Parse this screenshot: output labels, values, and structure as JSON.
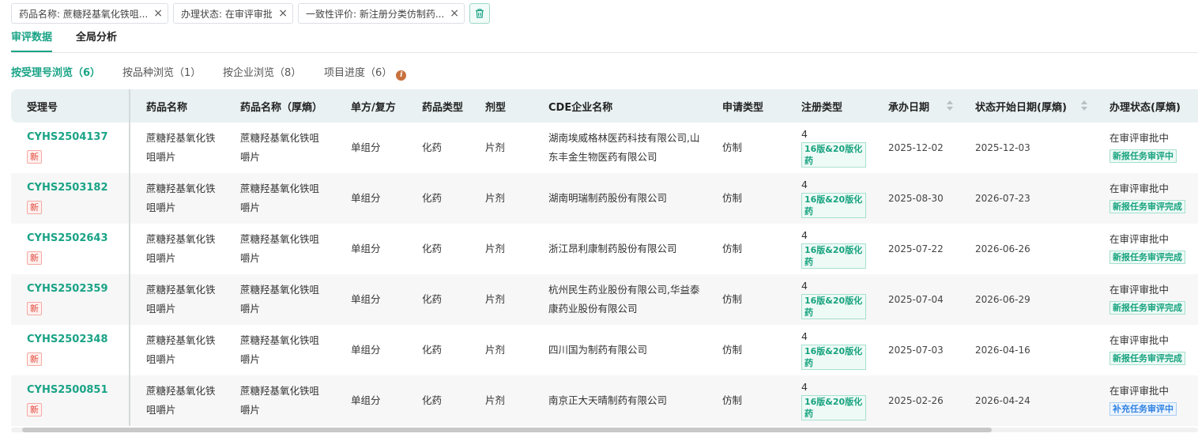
{
  "filters": [
    {
      "label": "药品名称: 蔗糖羟基氧化铁咀..."
    },
    {
      "label": "办理状态: 在审评审批中"
    },
    {
      "label": "一致性评价: 新注册分类仿制药..."
    }
  ],
  "filter_close_glyph": "×",
  "main_tabs": [
    {
      "label": "审评数据",
      "active": true
    },
    {
      "label": "全局分析",
      "active": false
    }
  ],
  "sub_tabs": [
    {
      "label": "按受理号浏览（6）",
      "active": true
    },
    {
      "label": "按品种浏览（1）",
      "active": false
    },
    {
      "label": "按企业浏览（8）",
      "active": false
    },
    {
      "label": "项目进度（6）",
      "active": false
    }
  ],
  "table": {
    "columns": [
      "受理号",
      "药品名称",
      "药品名称（厚熵）",
      "单方/复方",
      "药品类型",
      "剂型",
      "CDE企业名称",
      "申请类型",
      "注册类型",
      "承办日期",
      "状态开始日期(厚熵)",
      "办理状态(厚熵)"
    ],
    "rows": [
      {
        "acceptance_no": "CYHS2504137",
        "badge": "新",
        "drug_name": "蔗糖羟基氧化铁咀嚼片",
        "drug_name_alt": "蔗糖羟基氧化铁咀嚼片",
        "composition": "单组分",
        "drug_type": "化药",
        "dosage_form": "片剂",
        "company": "湖南埃威格林医药科技有限公司,山东丰金生物医药有限公司",
        "application_type": "仿制",
        "reg_class": "4",
        "reg_tag": "16版&20版化药",
        "undertake_date": "2025-12-02",
        "status_start_date": "2025-12-03",
        "status": "在审评审批中",
        "status_tag": "新报任务审评中",
        "status_tag_color": "green"
      },
      {
        "acceptance_no": "CYHS2503182",
        "badge": "新",
        "drug_name": "蔗糖羟基氧化铁咀嚼片",
        "drug_name_alt": "蔗糖羟基氧化铁咀嚼片",
        "composition": "单组分",
        "drug_type": "化药",
        "dosage_form": "片剂",
        "company": "湖南明瑞制药股份有限公司",
        "application_type": "仿制",
        "reg_class": "4",
        "reg_tag": "16版&20版化药",
        "undertake_date": "2025-08-30",
        "status_start_date": "2026-07-23",
        "status": "在审评审批中",
        "status_tag": "新报任务审评完成",
        "status_tag_color": "green"
      },
      {
        "acceptance_no": "CYHS2502643",
        "badge": "新",
        "drug_name": "蔗糖羟基氧化铁咀嚼片",
        "drug_name_alt": "蔗糖羟基氧化铁咀嚼片",
        "composition": "单组分",
        "drug_type": "化药",
        "dosage_form": "片剂",
        "company": "浙江昂利康制药股份有限公司",
        "application_type": "仿制",
        "reg_class": "4",
        "reg_tag": "16版&20版化药",
        "undertake_date": "2025-07-22",
        "status_start_date": "2026-06-26",
        "status": "在审评审批中",
        "status_tag": "新报任务审评完成",
        "status_tag_color": "green"
      },
      {
        "acceptance_no": "CYHS2502359",
        "badge": "新",
        "drug_name": "蔗糖羟基氧化铁咀嚼片",
        "drug_name_alt": "蔗糖羟基氧化铁咀嚼片",
        "composition": "单组分",
        "drug_type": "化药",
        "dosage_form": "片剂",
        "company": "杭州民生药业股份有限公司,华益泰康药业股份有限公司",
        "application_type": "仿制",
        "reg_class": "4",
        "reg_tag": "16版&20版化药",
        "undertake_date": "2025-07-04",
        "status_start_date": "2026-06-29",
        "status": "在审评审批中",
        "status_tag": "新报任务审评完成",
        "status_tag_color": "green"
      },
      {
        "acceptance_no": "CYHS2502348",
        "badge": "新",
        "drug_name": "蔗糖羟基氧化铁咀嚼片",
        "drug_name_alt": "蔗糖羟基氧化铁咀嚼片",
        "composition": "单组分",
        "drug_type": "化药",
        "dosage_form": "片剂",
        "company": "四川国为制药有限公司",
        "application_type": "仿制",
        "reg_class": "4",
        "reg_tag": "16版&20版化药",
        "undertake_date": "2025-07-03",
        "status_start_date": "2026-04-16",
        "status": "在审评审批中",
        "status_tag": "新报任务审评完成",
        "status_tag_color": "green"
      },
      {
        "acceptance_no": "CYHS2500851",
        "badge": "新",
        "drug_name": "蔗糖羟基氧化铁咀嚼片",
        "drug_name_alt": "蔗糖羟基氧化铁咀嚼片",
        "composition": "单组分",
        "drug_type": "化药",
        "dosage_form": "片剂",
        "company": "南京正大天晴制药有限公司",
        "application_type": "仿制",
        "reg_class": "4",
        "reg_tag": "16版&20版化药",
        "undertake_date": "2025-02-26",
        "status_start_date": "2026-04-24",
        "status": "在审评审批中",
        "status_tag": "补充任务审评中",
        "status_tag_color": "blue"
      }
    ]
  },
  "colors": {
    "accent": "#1aa386",
    "header_bg": "#e9f1f2",
    "new_badge": "#e0483b",
    "blue_tag": "#2f82e3",
    "info_icon": "#c8713e"
  }
}
